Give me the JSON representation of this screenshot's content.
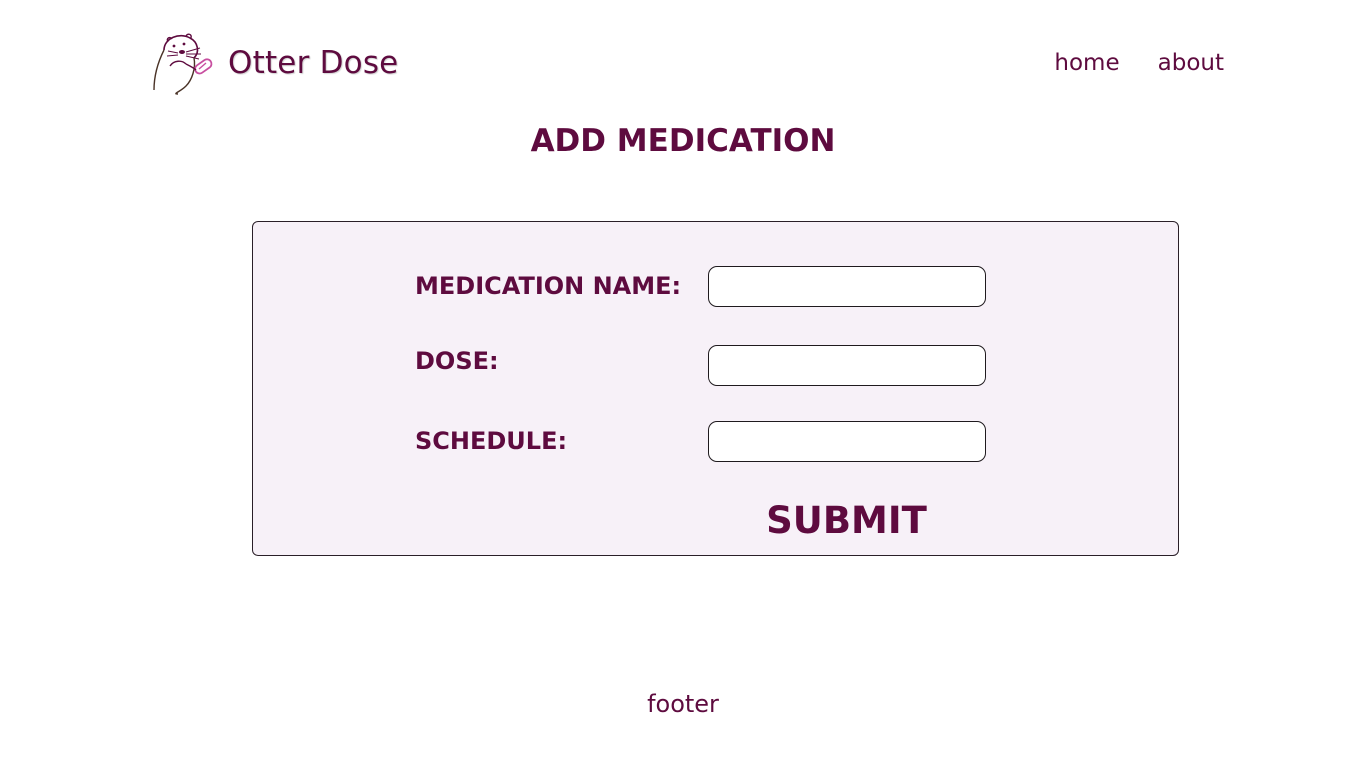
{
  "header": {
    "brand_name": "Otter Dose",
    "logo_icon": "otter-icon",
    "nav": [
      {
        "label": "home"
      },
      {
        "label": "about"
      }
    ]
  },
  "main": {
    "title": "ADD MEDICATION",
    "form": {
      "fields": [
        {
          "label": "MEDICATION NAME:",
          "value": "",
          "placeholder": ""
        },
        {
          "label": "DOSE:",
          "value": "",
          "placeholder": ""
        },
        {
          "label": "SCHEDULE:",
          "value": "",
          "placeholder": ""
        }
      ],
      "submit_label": "SUBMIT"
    }
  },
  "footer": {
    "text": "footer"
  },
  "colors": {
    "brand": "#5e0b3f",
    "card_background": "#f7f1f8",
    "logo_accent": "#c84fa0",
    "logo_outline": "#4a3327"
  }
}
